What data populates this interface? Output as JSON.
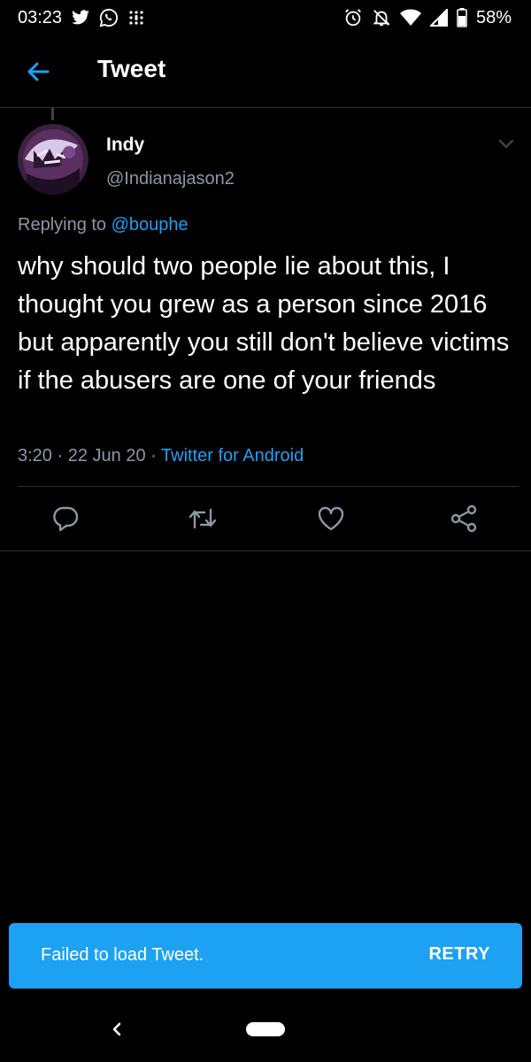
{
  "status_bar": {
    "time": "03:23",
    "battery": "58%",
    "left_icons": [
      "twitter-bird-icon",
      "whatsapp-icon",
      "slack-icon"
    ],
    "right_icons": [
      "alarm-icon",
      "notifications-off-icon",
      "wifi-icon",
      "signal-icon",
      "battery-icon"
    ]
  },
  "header": {
    "title": "Tweet"
  },
  "tweet": {
    "author_name": "Indy",
    "author_handle": "@Indianajason2",
    "replying_prefix": "Replying to",
    "replying_to": "@bouphe",
    "text": "why should two people lie about this, I thought you grew as a person since 2016 but apparently you still don't believe victims if the abusers are one of your friends",
    "time": "3:20",
    "date": "22 Jun 20",
    "source": "Twitter for Android",
    "separator": "·"
  },
  "actions": [
    "reply-icon",
    "retweet-icon",
    "like-icon",
    "share-icon"
  ],
  "snackbar": {
    "message": "Failed to load Tweet.",
    "action_label": "RETRY"
  },
  "colors": {
    "background": "#000000",
    "accent": "#1da1f2",
    "secondary_text": "#8b98a5",
    "divider": "#2f3336",
    "icon_gray": "#8b98a5"
  }
}
